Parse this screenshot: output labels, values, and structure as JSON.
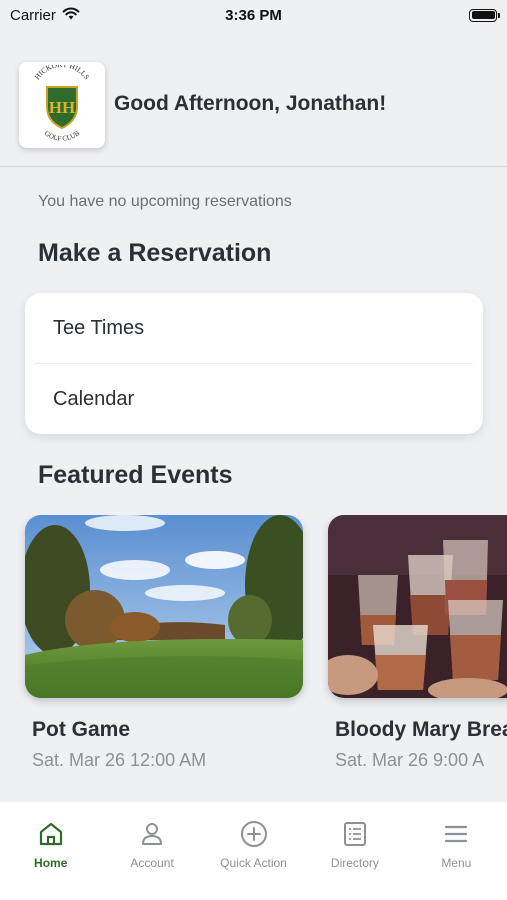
{
  "status_bar": {
    "carrier": "Carrier",
    "time": "3:36 PM"
  },
  "header": {
    "greeting": "Good Afternoon, Jonathan!",
    "logo": {
      "top_text": "HICKORY HILLS",
      "monogram": "HH",
      "bottom_text": "GOLF CLUB"
    }
  },
  "reservations": {
    "empty_message": "You have no upcoming reservations",
    "section_title": "Make a Reservation",
    "options": [
      "Tee Times",
      "Calendar"
    ]
  },
  "events": {
    "section_title": "Featured Events",
    "items": [
      {
        "name": "Pot Game",
        "date": "Sat. Mar 26 12:00 AM"
      },
      {
        "name": "Bloody Mary Brea",
        "date": "Sat. Mar 26 9:00 A"
      }
    ]
  },
  "tabbar": {
    "tabs": [
      {
        "label": "Home",
        "icon": "home-icon",
        "active": true
      },
      {
        "label": "Account",
        "icon": "account-icon",
        "active": false
      },
      {
        "label": "Quick Action",
        "icon": "plus-circle-icon",
        "active": false
      },
      {
        "label": "Directory",
        "icon": "directory-icon",
        "active": false
      },
      {
        "label": "Menu",
        "icon": "menu-icon",
        "active": false
      }
    ]
  },
  "colors": {
    "accent": "#2f6b2a",
    "background": "#eef0f3",
    "text": "#2b2f36",
    "muted": "#8d9197"
  }
}
